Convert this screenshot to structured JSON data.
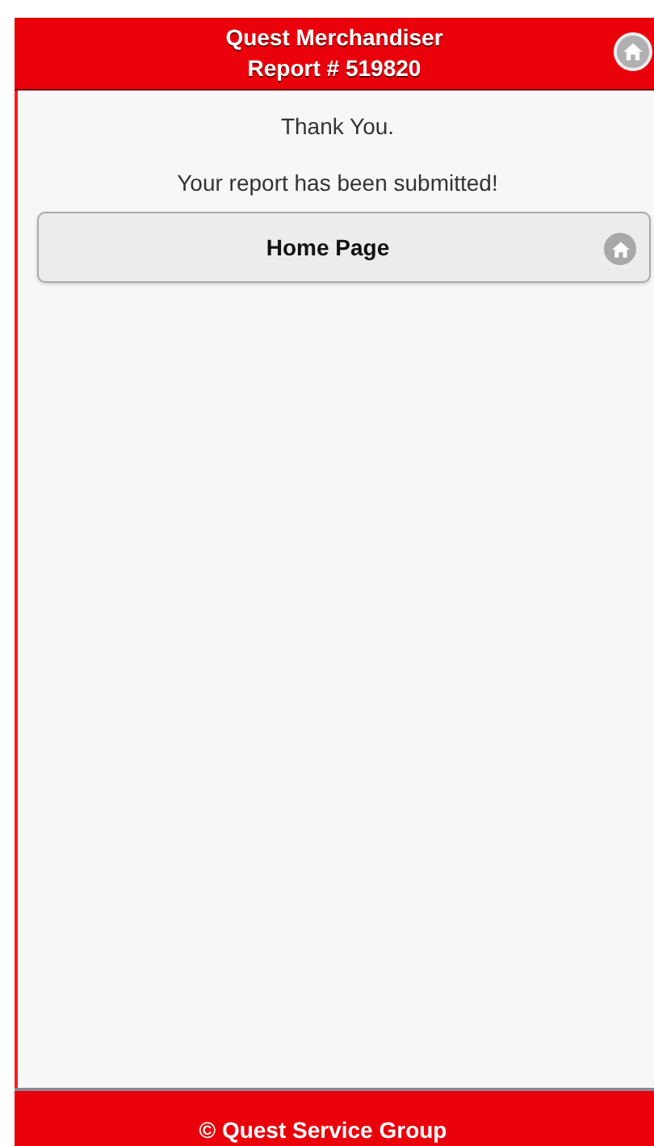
{
  "header": {
    "title_lines": [
      "Quest Merchandiser",
      "Report # 519820"
    ]
  },
  "messages": [
    "Thank You.",
    "Your report has been submitted!"
  ],
  "buttons": [
    {
      "label": "Home Page"
    }
  ],
  "footer": {
    "text": "© Quest Service Group"
  }
}
